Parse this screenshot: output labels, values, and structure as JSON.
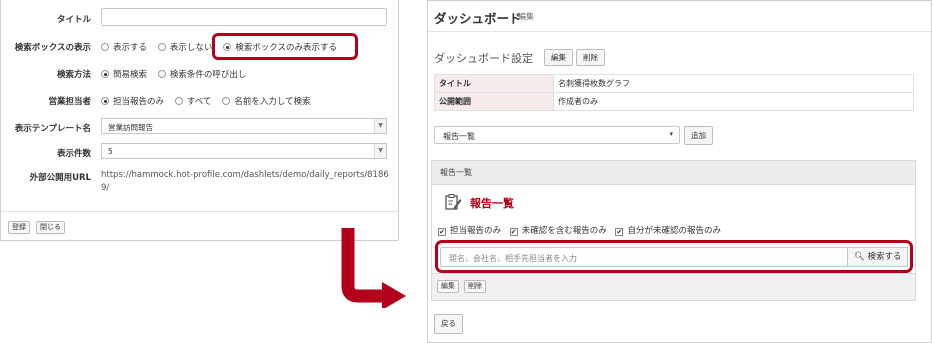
{
  "left_form": {
    "fields": [
      {
        "label": "タイトル",
        "type": "text",
        "value": ""
      },
      {
        "label": "検索ボックスの表示",
        "type": "radio",
        "options": [
          "表示する",
          "表示しない",
          "検索ボックスのみ表示する"
        ],
        "selected": 2
      },
      {
        "label": "検索方法",
        "type": "radio",
        "options": [
          "簡易検索",
          "検索条件の呼び出し"
        ],
        "selected": 0
      },
      {
        "label": "営業担当者",
        "type": "radio",
        "options": [
          "担当報告のみ",
          "すべて",
          "名前を入力して検索"
        ],
        "selected": 0
      },
      {
        "label": "表示テンプレート名",
        "type": "select",
        "value": "営業訪問報告"
      },
      {
        "label": "表示件数",
        "type": "select",
        "value": "5"
      },
      {
        "label": "外部公開用URL",
        "type": "url",
        "value": "https://hammock.hot-profile.com/dashlets/demo/daily_reports/81869/"
      }
    ],
    "buttons": {
      "register": "登録",
      "close": "閉じる"
    }
  },
  "right_panel": {
    "title": "ダッシュボード",
    "title_sub": "編集",
    "settings_title": "ダッシュボード設定",
    "settings_buttons": {
      "edit": "編集",
      "delete": "削除"
    },
    "settings_table": [
      {
        "key": "タイトル",
        "value": "名刺獲得枚数グラフ"
      },
      {
        "key": "公開範囲",
        "value": "作成者のみ"
      }
    ],
    "dashlet_select": "報告一覧",
    "add_button": "追加",
    "section_label": "報告一覧",
    "report": {
      "title": "報告一覧",
      "checkboxes": [
        "担当報告のみ",
        "未確認を含む報告のみ",
        "自分が未確認の報告のみ"
      ],
      "search_placeholder": "題名、会社名、相手先担当者を入力",
      "search_button": "検索する",
      "footer_buttons": {
        "edit": "編集",
        "delete": "削除"
      }
    },
    "back_button": "戻る"
  },
  "colors": {
    "highlight": "#b3001b",
    "arrow": "#b3001b"
  }
}
